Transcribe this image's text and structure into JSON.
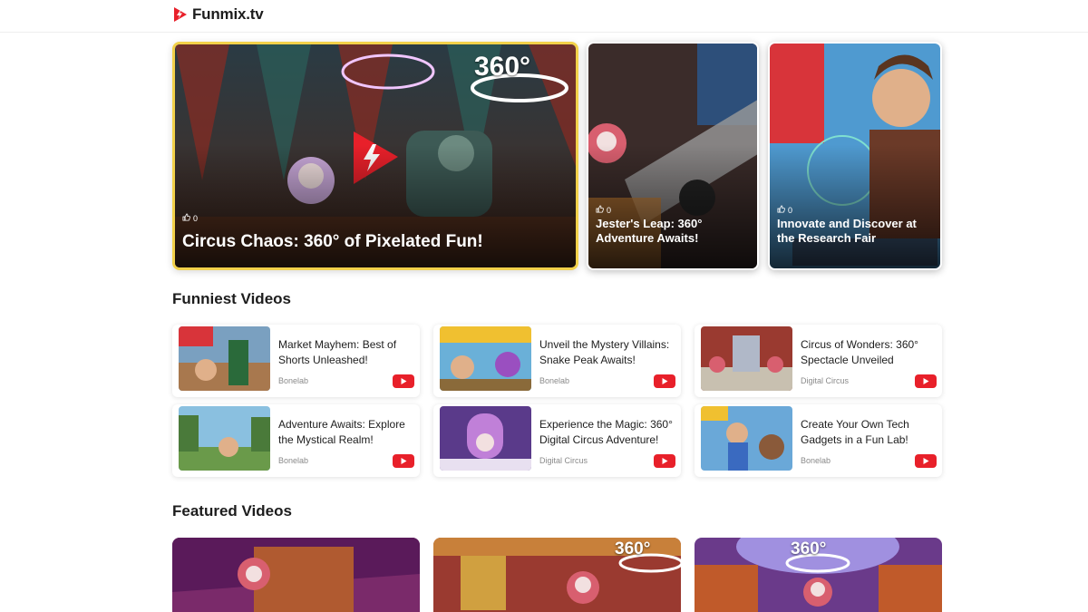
{
  "brand": {
    "name": "Funmix.tv",
    "logo_icon": "play-bolt-icon",
    "accent": "#e8202a"
  },
  "hero": {
    "main": {
      "likes": "0",
      "title": "Circus Chaos: 360° of Pixelated Fun!",
      "badge": "360°"
    },
    "side": [
      {
        "likes": "0",
        "title": "Jester's Leap: 360° Adventure Awaits!"
      },
      {
        "likes": "0",
        "title": "Innovate and Discover at the Research Fair"
      }
    ]
  },
  "funniest": {
    "heading": "Funniest Videos",
    "items": [
      {
        "title": "Market Mayhem: Best of Shorts Unleashed!",
        "channel": "Bonelab"
      },
      {
        "title": "Unveil the Mystery Villains: Snake Peak Awaits!",
        "channel": "Bonelab"
      },
      {
        "title": "Circus of Wonders: 360° Spectacle Unveiled",
        "channel": "Digital Circus"
      },
      {
        "title": "Adventure Awaits: Explore the Mystical Realm!",
        "channel": "Bonelab"
      },
      {
        "title": "Experience the Magic: 360° Digital Circus Adventure!",
        "channel": "Digital Circus"
      },
      {
        "title": "Create Your Own Tech Gadgets in a Fun Lab!",
        "channel": "Bonelab"
      }
    ]
  },
  "featured": {
    "heading": "Featured Videos",
    "items": [
      {
        "badge": ""
      },
      {
        "badge": "360°"
      },
      {
        "badge": "360°"
      }
    ]
  }
}
